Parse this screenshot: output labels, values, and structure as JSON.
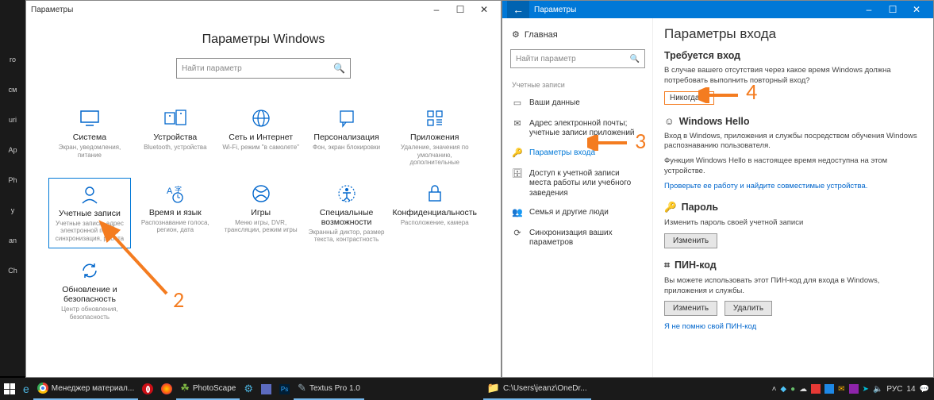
{
  "sidebar_left": [
    "",
    "ro",
    "",
    "см",
    "uri",
    "",
    "Ap",
    "Ph",
    "у",
    "an",
    "",
    "Ch"
  ],
  "win1": {
    "titlebar": {
      "title": "Параметры",
      "min": "–",
      "max": "☐",
      "close": "✕"
    },
    "page_title": "Параметры Windows",
    "search_placeholder": "Найти параметр",
    "tiles": [
      {
        "icon": "monitor",
        "title": "Система",
        "desc": "Экран, уведомления, питание"
      },
      {
        "icon": "devices",
        "title": "Устройства",
        "desc": "Bluetooth, устройства"
      },
      {
        "icon": "globe",
        "title": "Сеть и Интернет",
        "desc": "Wi-Fi, режим \"в самолете\""
      },
      {
        "icon": "brush",
        "title": "Персонализация",
        "desc": "Фон, экран блокировки"
      },
      {
        "icon": "apps",
        "title": "Приложения",
        "desc": "Удаление, значения по умолчанию, дополнительные"
      },
      {
        "icon": "person",
        "title": "Учетные записи",
        "desc": "Учетные записи, адрес электронной почты, синхронизация, работа",
        "selected": true
      },
      {
        "icon": "clock",
        "title": "Время и язык",
        "desc": "Распознавание голоса, регион, дата"
      },
      {
        "icon": "xbox",
        "title": "Игры",
        "desc": "Меню игры, DVR, трансляции, режим игры"
      },
      {
        "icon": "access",
        "title": "Специальные возможности",
        "desc": "Экранный диктор, размер текста, контрастность"
      },
      {
        "icon": "lock",
        "title": "Конфиденциальность",
        "desc": "Расположение, камера"
      },
      {
        "icon": "sync",
        "title": "Обновление и безопасность",
        "desc": "Центр обновления, безопасность"
      }
    ],
    "arrow_number": "2"
  },
  "win2": {
    "titlebar": {
      "title": "Параметры",
      "min": "–",
      "max": "☐",
      "close": "✕"
    },
    "nav": {
      "home": "Главная",
      "search_placeholder": "Найти параметр",
      "section": "Учетные записи",
      "items": [
        {
          "icon": "card",
          "label": "Ваши данные"
        },
        {
          "icon": "mail",
          "label": "Адрес электронной почты; учетные записи приложений"
        },
        {
          "icon": "key",
          "label": "Параметры входа",
          "active": true
        },
        {
          "icon": "briefcase",
          "label": "Доступ к учетной записи места работы или учебного заведения"
        },
        {
          "icon": "family",
          "label": "Семья и другие люди"
        },
        {
          "icon": "syncset",
          "label": "Синхронизация ваших параметров"
        }
      ]
    },
    "content": {
      "h1": "Параметры входа",
      "req_h": "Требуется вход",
      "req_p": "В случае вашего отсутствия через какое время Windows должна потребовать выполнить повторный вход?",
      "req_val": "Никогда",
      "hello_h": "Windows Hello",
      "hello_p1": "Вход в Windows, приложения и службы посредством обучения Windows распознаванию пользователя.",
      "hello_p2": "Функция Windows Hello в настоящее время недоступна на этом устройстве.",
      "hello_link": "Проверьте ее работу и найдите совместимые устройства.",
      "pwd_h": "Пароль",
      "pwd_p": "Изменить пароль своей учетной записи",
      "pwd_btn": "Изменить",
      "pin_h": "ПИН-код",
      "pin_p": "Вы можете использовать этот ПИН-код для входа в Windows, приложения и службы.",
      "pin_btn1": "Изменить",
      "pin_btn2": "Удалить",
      "pin_link": "Я не помню свой ПИН-код"
    },
    "arrow3": "3",
    "arrow4": "4"
  },
  "taskbar": {
    "items": [
      {
        "icon": "win",
        "label": ""
      },
      {
        "icon": "edge",
        "label": ""
      },
      {
        "icon": "chrome",
        "label": "Менеджер материал..."
      },
      {
        "icon": "opera",
        "label": ""
      },
      {
        "icon": "ff",
        "label": ""
      },
      {
        "icon": "ps",
        "label": "PhotoScape"
      },
      {
        "icon": "gear",
        "label": ""
      },
      {
        "icon": "note",
        "label": ""
      },
      {
        "icon": "psd",
        "label": ""
      },
      {
        "icon": "textus",
        "label": "Textus Pro 1.0"
      }
    ],
    "items_right": [
      {
        "icon": "folder",
        "label": "C:\\Users\\jeanz\\OneDr..."
      }
    ],
    "tray": {
      "lang": "РУС",
      "time": "14"
    }
  }
}
